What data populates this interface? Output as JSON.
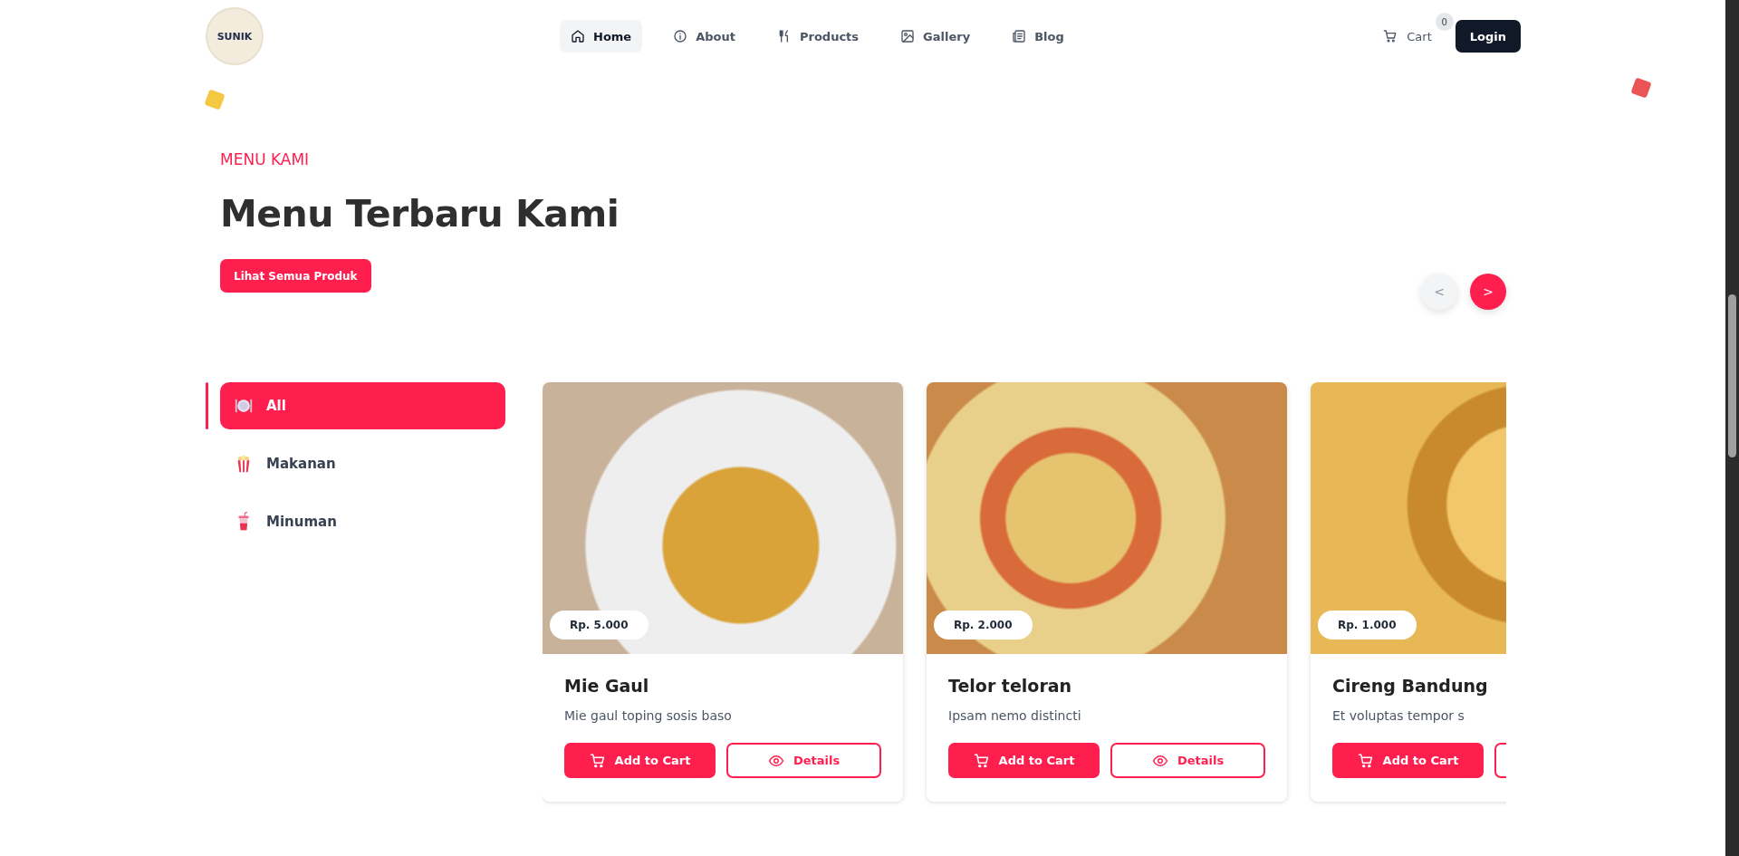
{
  "nav": {
    "logo_text": "SUNIK",
    "links": [
      {
        "label": "Home",
        "selected": true
      },
      {
        "label": "About",
        "selected": false
      },
      {
        "label": "Products",
        "selected": false
      },
      {
        "label": "Gallery",
        "selected": false
      },
      {
        "label": "Blog",
        "selected": false
      }
    ],
    "cart": {
      "label": "Cart",
      "count": "0"
    },
    "login": "Login"
  },
  "section": {
    "eyebrow": "MENU KAMI",
    "title": "Menu Terbaru Kami",
    "cta": "Lihat Semua Produk",
    "prev": "<",
    "next": ">"
  },
  "categories": [
    {
      "label": "All",
      "selected": true
    },
    {
      "label": "Makanan",
      "selected": false
    },
    {
      "label": "Minuman",
      "selected": false
    }
  ],
  "products": [
    {
      "name": "Mie Gaul",
      "description": "Mie gaul toping sosis baso",
      "price": "Rp. 5.000",
      "add": "Add to Cart",
      "details": "Details"
    },
    {
      "name": "Telor teloran",
      "description": "Ipsam nemo distincti",
      "price": "Rp. 2.000",
      "add": "Add to Cart",
      "details": "Details"
    },
    {
      "name": "Cireng Bandung",
      "description": "Et voluptas tempor s",
      "price": "Rp. 1.000",
      "add": "Add to Cart"
    }
  ]
}
